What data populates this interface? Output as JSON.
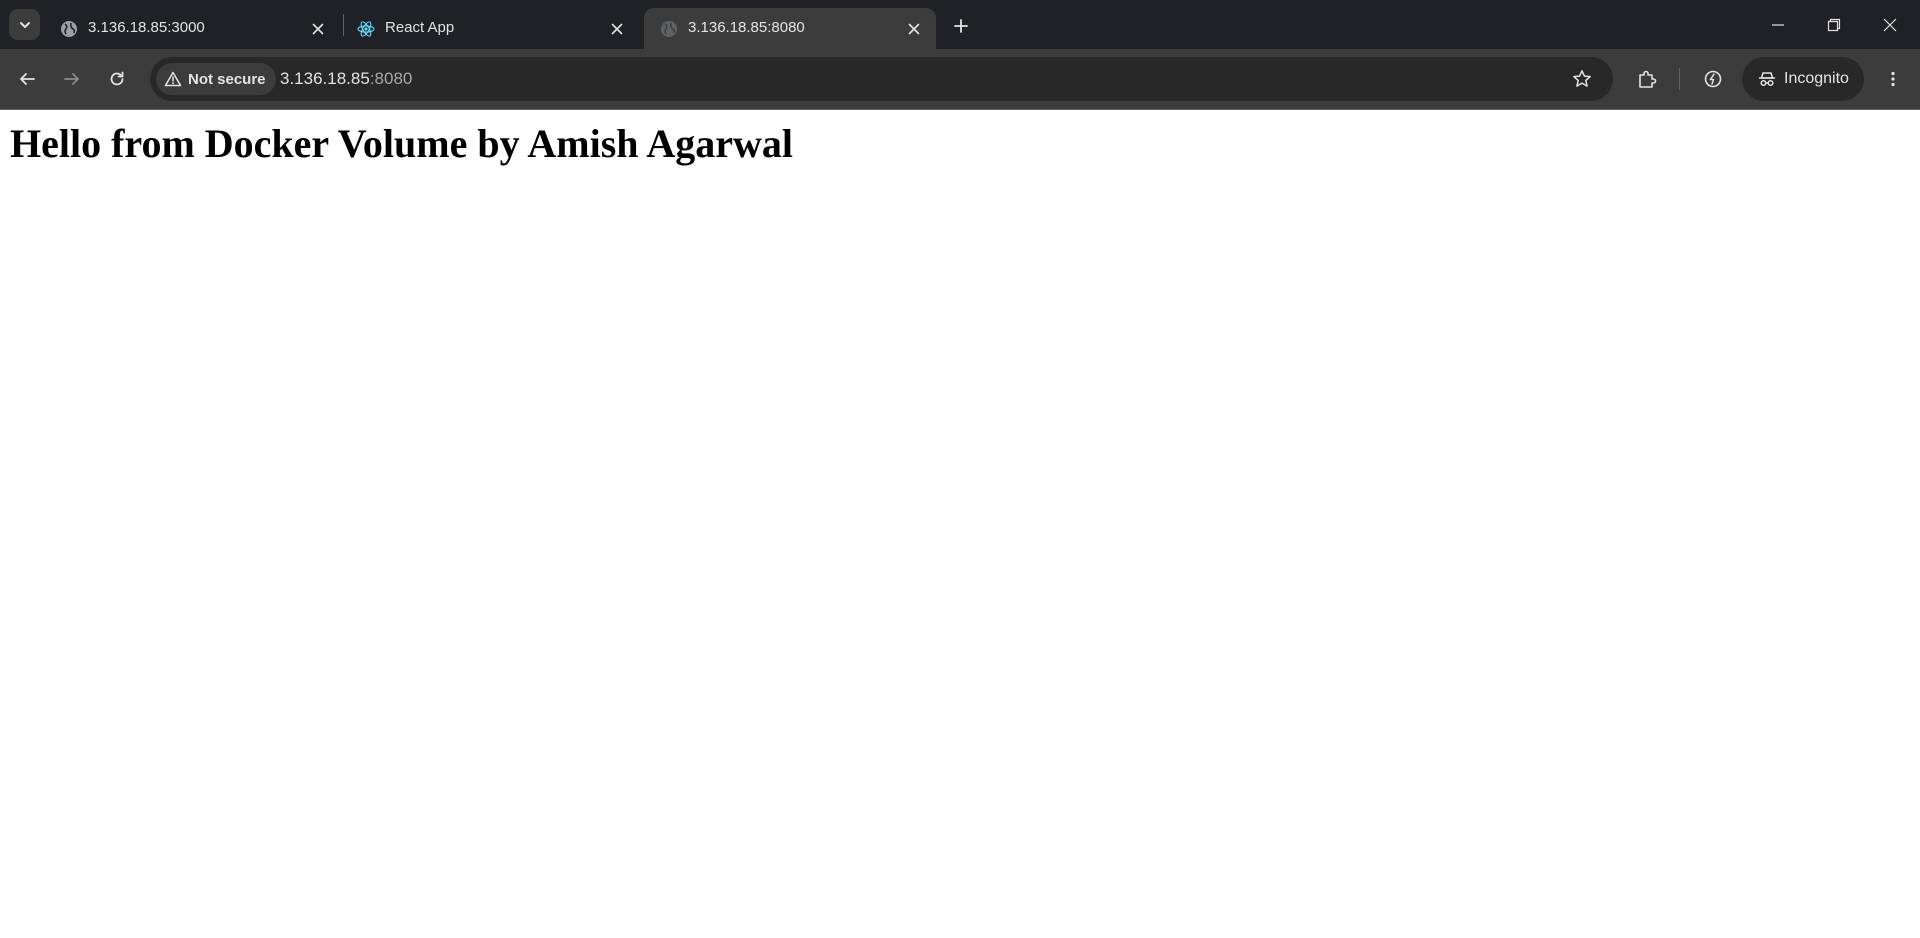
{
  "browser": {
    "tabs": [
      {
        "title": "3.136.18.85:3000",
        "favicon": "globe-icon",
        "active": false
      },
      {
        "title": "React App",
        "favicon": "react-icon",
        "active": false
      },
      {
        "title": "3.136.18.85:8080",
        "favicon": "globe-icon",
        "active": true
      }
    ],
    "address_bar": {
      "security_label": "Not secure",
      "url_host": "3.136.18.85",
      "url_port": ":8080"
    },
    "profile_label": "Incognito"
  },
  "page": {
    "heading": "Hello from Docker Volume by Amish Agarwal"
  },
  "colors": {
    "tabstrip_bg": "#202124",
    "toolbar_bg": "#3c3c3c",
    "react_accent": "#61dafb"
  }
}
